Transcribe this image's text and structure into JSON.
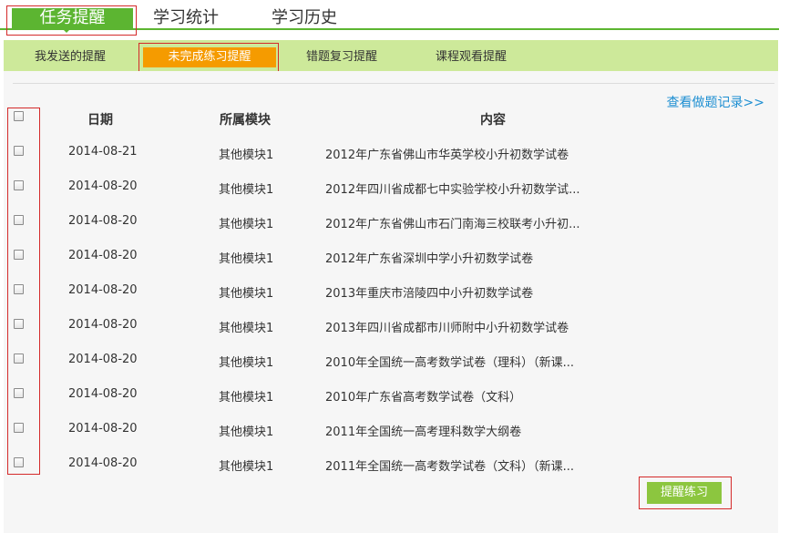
{
  "top_tabs": [
    "任务提醒",
    "学习统计",
    "学习历史"
  ],
  "sub_tabs": [
    "我发送的提醒",
    "未完成练习提醒",
    "错题复习提醒",
    "课程观看提醒"
  ],
  "history_link": "查看做题记录>>",
  "table": {
    "headers": {
      "date": "日期",
      "module": "所属模块",
      "content": "内容"
    },
    "rows": [
      {
        "date": "2014-08-21",
        "module": "其他模块1",
        "content": "2012年广东省佛山市华英学校小升初数学试卷"
      },
      {
        "date": "2014-08-20",
        "module": "其他模块1",
        "content": "2012年四川省成都七中实验学校小升初数学试..."
      },
      {
        "date": "2014-08-20",
        "module": "其他模块1",
        "content": "2012年广东省佛山市石门南海三校联考小升初..."
      },
      {
        "date": "2014-08-20",
        "module": "其他模块1",
        "content": "2012年广东省深圳中学小升初数学试卷"
      },
      {
        "date": "2014-08-20",
        "module": "其他模块1",
        "content": "2013年重庆市涪陵四中小升初数学试卷"
      },
      {
        "date": "2014-08-20",
        "module": "其他模块1",
        "content": "2013年四川省成都市川师附中小升初数学试卷"
      },
      {
        "date": "2014-08-20",
        "module": "其他模块1",
        "content": "2010年全国统一高考数学试卷（理科）（新课..."
      },
      {
        "date": "2014-08-20",
        "module": "其他模块1",
        "content": "2010年广东省高考数学试卷（文科）"
      },
      {
        "date": "2014-08-20",
        "module": "其他模块1",
        "content": "2011年全国统一高考理科数学大纲卷"
      },
      {
        "date": "2014-08-20",
        "module": "其他模块1",
        "content": "2011年全国统一高考数学试卷（文科）（新课..."
      }
    ]
  },
  "remind_button": "提醒练习",
  "colors": {
    "green": "#5cb531",
    "light_green": "#cde99a",
    "orange": "#f59b00",
    "link_blue": "#1e8fd2",
    "button_green": "#8cc63f",
    "highlight_red": "#d42a2a"
  }
}
